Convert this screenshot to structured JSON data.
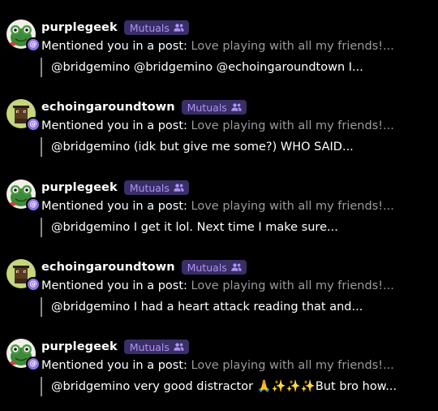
{
  "notifications": [
    {
      "username": "purplegeek",
      "badge": "Mutuals",
      "action": "Mentioned you in a post:",
      "preview": "Love playing with all my friends!...",
      "quote": "@bridgemino @bridgemino @echoingaroundtown I...",
      "avatar_icon": "frog-avatar-icon",
      "avatar_badge": "@"
    },
    {
      "username": "echoingaroundtown",
      "badge": "Mutuals",
      "action": "Mentioned you in a post:",
      "preview": "Love playing with all my friends!...",
      "quote": "@bridgemino (idk but give me some?) WHO SAID...",
      "avatar_icon": "pixel-character-avatar-icon",
      "avatar_badge": "@"
    },
    {
      "username": "purplegeek",
      "badge": "Mutuals",
      "action": "Mentioned you in a post:",
      "preview": "Love playing with all my friends!...",
      "quote": "@bridgemino I get it lol. Next time I make sure...",
      "avatar_icon": "frog-avatar-icon",
      "avatar_badge": "@"
    },
    {
      "username": "echoingaroundtown",
      "badge": "Mutuals",
      "action": "Mentioned you in a post:",
      "preview": "Love playing with all my friends!...",
      "quote": "@bridgemino I had a heart attack reading that and...",
      "avatar_icon": "pixel-character-avatar-icon",
      "avatar_badge": "@"
    },
    {
      "username": "purplegeek",
      "badge": "Mutuals",
      "action": "Mentioned you in a post:",
      "preview": "Love playing with all my friends!...",
      "quote": "@bridgemino very good distractor 🙏✨✨✨But bro how...",
      "avatar_icon": "frog-avatar-icon",
      "avatar_badge": "@"
    }
  ],
  "colors": {
    "background": "#000000",
    "badge_bg": "#3b2d66",
    "badge_text": "#a995f2",
    "mention_badge": "#8e6fe8",
    "preview_text": "#9b9b9b"
  }
}
